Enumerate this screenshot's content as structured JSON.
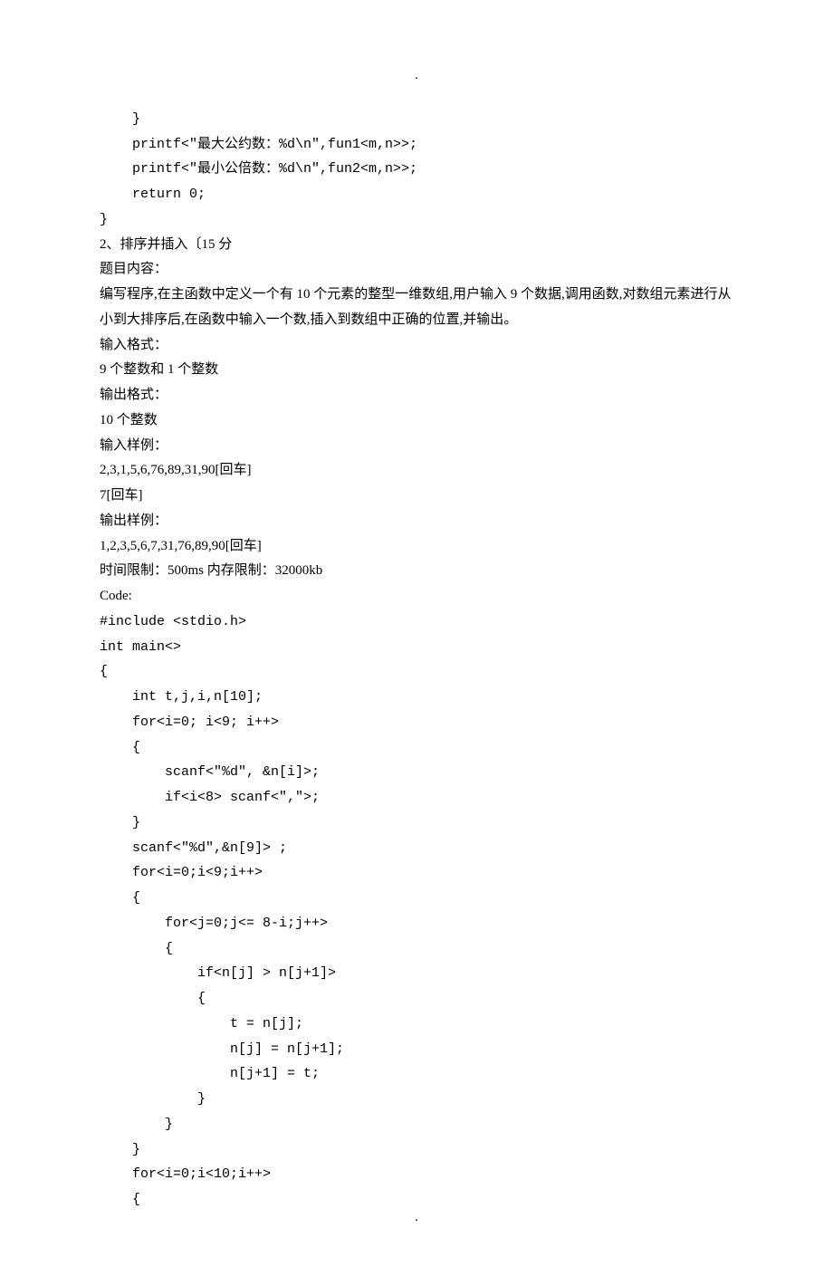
{
  "header_dot": ".",
  "footer_dot": ".",
  "code_block_1": "    }\n    printf<\"最大公约数：%d\\n\",fun1<m,n>>;\n    printf<\"最小公倍数：%d\\n\",fun2<m,n>>;\n    return 0;\n}",
  "problem": {
    "title": "2、排序并插入〔15 分",
    "section1_label": "题目内容：",
    "section1_body": "  编写程序,在主函数中定义一个有 10 个元素的整型一维数组,用户输入 9 个数据,调用函数,对数组元素进行从小到大排序后,在函数中输入一个数,插入到数组中正确的位置,并输出。",
    "input_format_label": "输入格式：",
    "input_format_body": " 9 个整数和 1 个整数",
    "output_format_label": "输出格式：",
    "output_format_body": " 10 个整数",
    "input_sample_label": "输入样例：",
    "input_sample_line1": "2,3,1,5,6,76,89,31,90[回车]",
    "input_sample_line2": "7[回车]",
    "output_sample_label": "输出样例：",
    "output_sample_line1": "1,2,3,5,6,7,31,76,89,90[回车]",
    "limits": "时间限制：500ms 内存限制：32000kb",
    "code_label": "Code:"
  },
  "code_block_2": "#include <stdio.h>\nint main<>\n{\n    int t,j,i,n[10];\n    for<i=0; i<9; i++>\n    {\n        scanf<\"%d\", &n[i]>;\n        if<i<8> scanf<\",\">;\n    }\n    scanf<\"%d\",&n[9]> ;\n    for<i=0;i<9;i++>\n    {\n        for<j=0;j<= 8-i;j++>\n        {\n            if<n[j] > n[j+1]>\n            {\n                t = n[j];\n                n[j] = n[j+1];\n                n[j+1] = t;\n            }\n        }\n    }\n    for<i=0;i<10;i++>\n    {"
}
